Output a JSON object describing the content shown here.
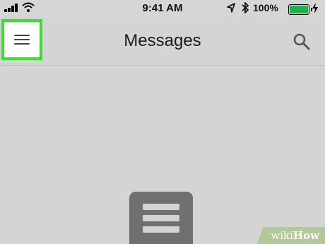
{
  "status_bar": {
    "time": "9:41 AM",
    "battery_percent": "100%",
    "battery_level": 1.0,
    "battery_color": "#22b14c",
    "icons": [
      "signal-icon",
      "wifi-icon",
      "location-icon",
      "bluetooth-icon",
      "battery-icon",
      "charging-icon"
    ]
  },
  "header": {
    "title": "Messages",
    "menu_icon": "hamburger-menu-icon",
    "search_icon": "search-icon",
    "highlight_color": "#39e033"
  },
  "main": {
    "empty_state_icon": "message-list-icon"
  },
  "watermark": {
    "prefix": "wiki",
    "suffix": "How"
  }
}
